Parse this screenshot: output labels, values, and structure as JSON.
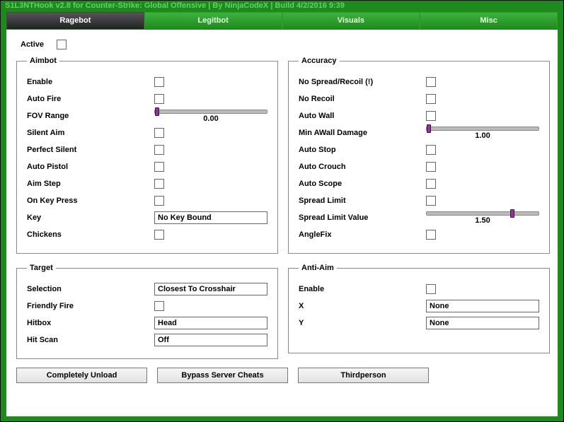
{
  "title": "S1L3NTHook v2.8 for Counter-Strike: Global Offensive | By NinjaCodeX | Build 4/2/2016 9:39",
  "tabs": [
    "Ragebot",
    "Legitbot",
    "Visuals",
    "Misc"
  ],
  "active_label": "Active",
  "groups": {
    "aimbot": {
      "legend": "Aimbot",
      "enable": "Enable",
      "autofire": "Auto Fire",
      "fov": "FOV Range",
      "fov_val": "0.00",
      "silent": "Silent Aim",
      "psilent": "Perfect Silent",
      "autopistol": "Auto Pistol",
      "aimstep": "Aim Step",
      "onkey": "On Key Press",
      "key": "Key",
      "key_val": "No Key Bound",
      "chickens": "Chickens"
    },
    "accuracy": {
      "legend": "Accuracy",
      "nospread": "No Spread/Recoil (!)",
      "norecoil": "No Recoil",
      "autowall": "Auto Wall",
      "minawall": "Min AWall Damage",
      "minawall_val": "1.00",
      "autostop": "Auto Stop",
      "autocrouch": "Auto Crouch",
      "autoscope": "Auto Scope",
      "spreadlimit": "Spread Limit",
      "spreadlimit_v": "Spread Limit Value",
      "spreadlimit_val": "1.50",
      "anglefix": "AngleFix"
    },
    "target": {
      "legend": "Target",
      "selection": "Selection",
      "selection_val": "Closest To Crosshair",
      "ff": "Friendly Fire",
      "hitbox": "Hitbox",
      "hitbox_val": "Head",
      "hitscan": "Hit Scan",
      "hitscan_val": "Off"
    },
    "antiaim": {
      "legend": "Anti-Aim",
      "enable": "Enable",
      "x": "X",
      "x_val": "None",
      "y": "Y",
      "y_val": "None"
    }
  },
  "buttons": {
    "unload": "Completely Unload",
    "bypass": "Bypass Server Cheats",
    "third": "Thirdperson"
  }
}
